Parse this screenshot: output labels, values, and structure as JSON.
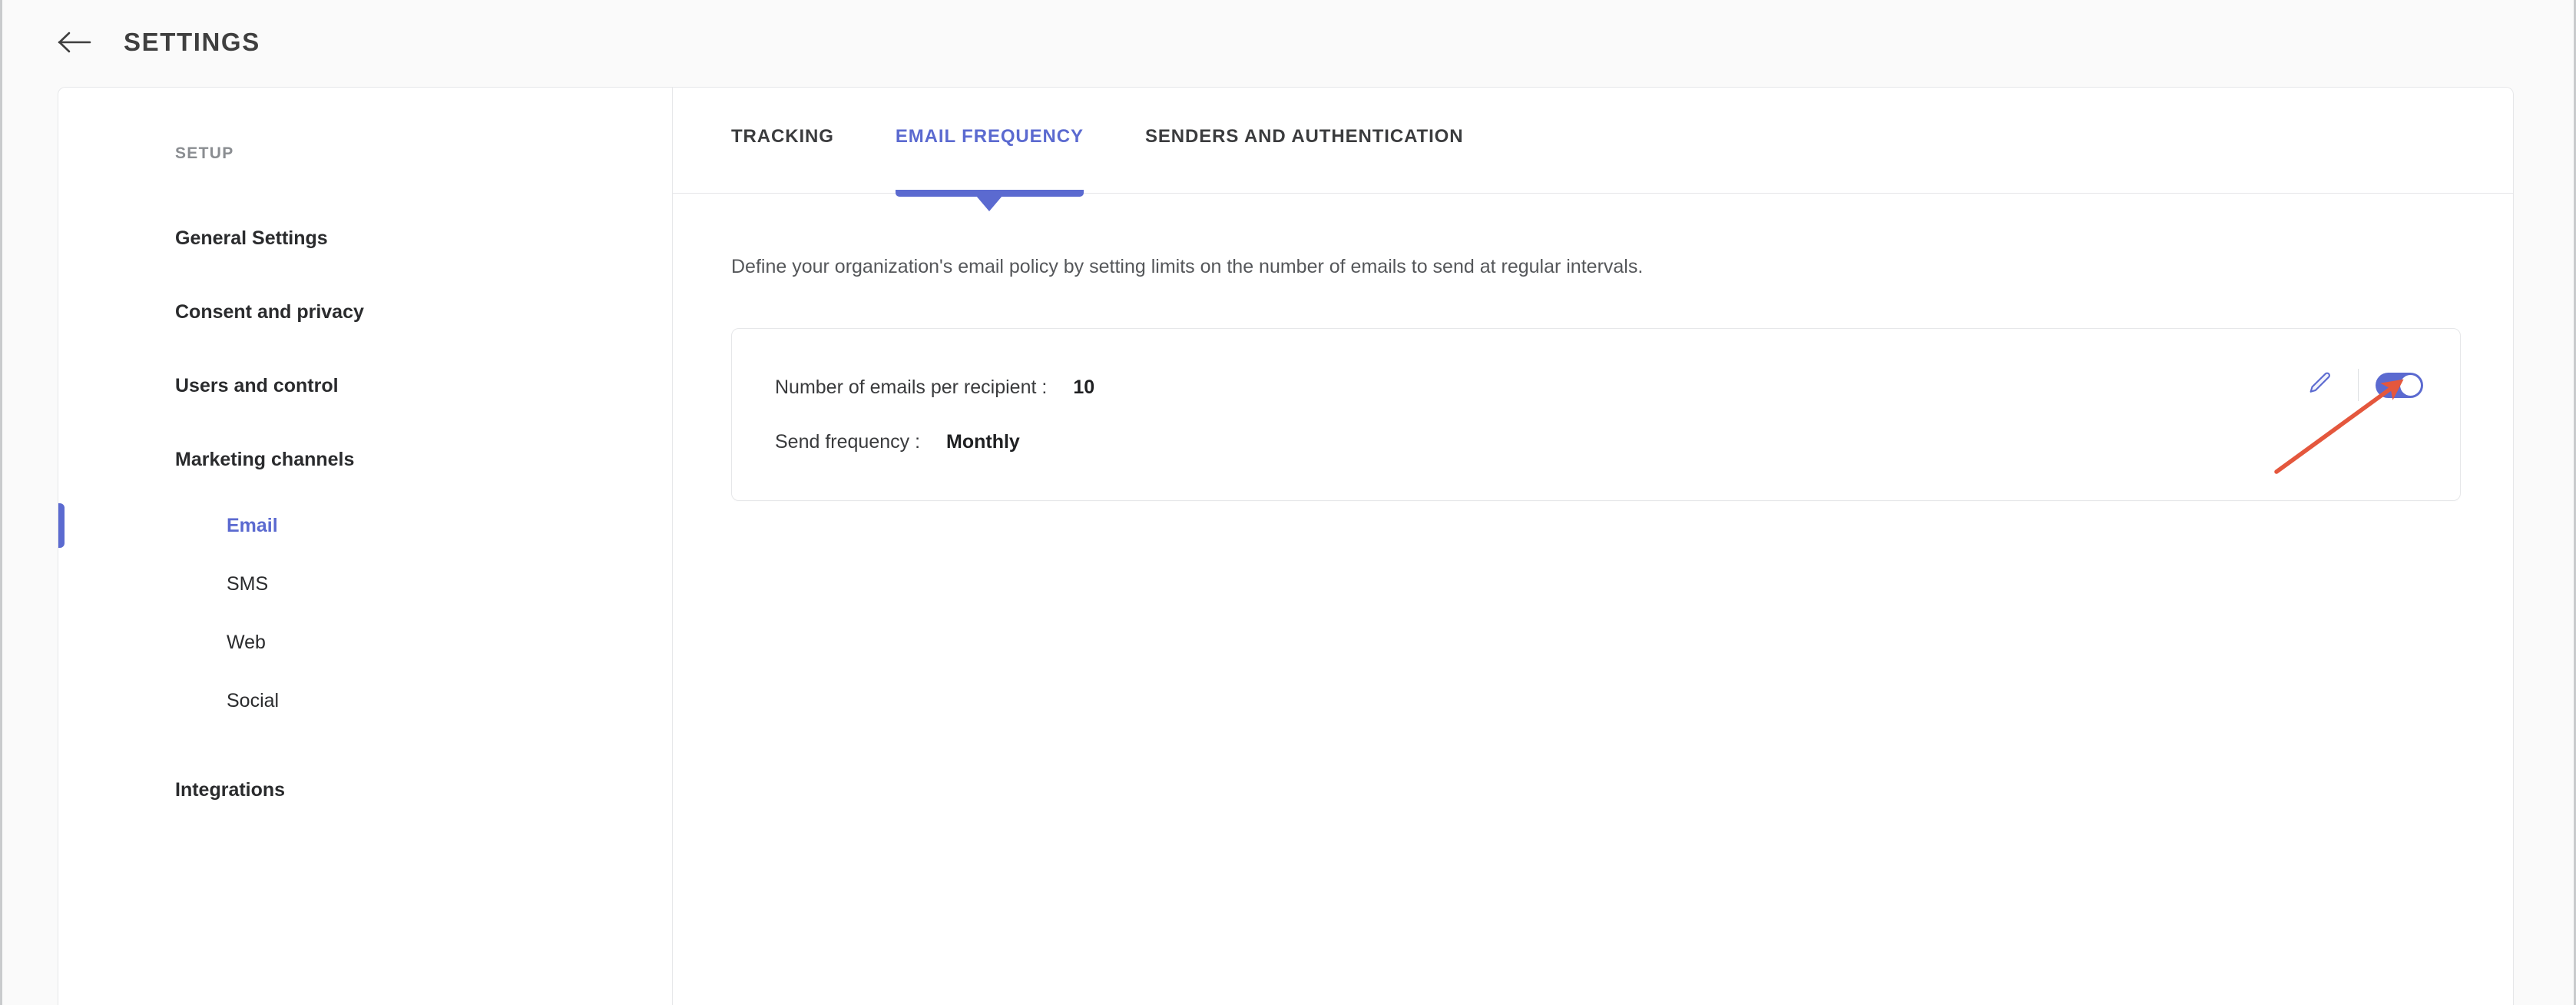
{
  "header": {
    "title": "SETTINGS",
    "back_icon": "arrow-left-icon"
  },
  "sidebar": {
    "section_label": "SETUP",
    "items": [
      {
        "label": "General Settings",
        "level": "top",
        "active": false
      },
      {
        "label": "Consent and privacy",
        "level": "top",
        "active": false
      },
      {
        "label": "Users and control",
        "level": "top",
        "active": false
      },
      {
        "label": "Marketing channels",
        "level": "top",
        "active": false
      },
      {
        "label": "Email",
        "level": "sub",
        "active": true
      },
      {
        "label": "SMS",
        "level": "sub",
        "active": false
      },
      {
        "label": "Web",
        "level": "sub",
        "active": false
      },
      {
        "label": "Social",
        "level": "sub",
        "active": false
      },
      {
        "label": "Integrations",
        "level": "top",
        "active": false
      }
    ]
  },
  "tabs": [
    {
      "label": "TRACKING",
      "active": false
    },
    {
      "label": "EMAIL FREQUENCY",
      "active": true
    },
    {
      "label": "SENDERS AND AUTHENTICATION",
      "active": false
    }
  ],
  "main": {
    "description": "Define your organization's email policy by setting limits on the number of emails to send at regular intervals.",
    "policy_card": {
      "emails_per_recipient_label": "Number of emails per recipient :",
      "emails_per_recipient_value": "10",
      "send_frequency_label": "Send frequency :",
      "send_frequency_value": "Monthly",
      "edit_icon": "pencil-icon",
      "toggle_state": "on"
    }
  },
  "annotation": {
    "type": "arrow",
    "color": "#e4573d",
    "points_to": "policy-enable-toggle"
  },
  "colors": {
    "accent": "#5b6ad0",
    "page_background": "#fafafa",
    "panel_background": "#ffffff",
    "border": "#e6e7e9",
    "text_primary": "#2a2b2d",
    "text_muted": "#8a8d91",
    "annotation": "#e4573d"
  }
}
